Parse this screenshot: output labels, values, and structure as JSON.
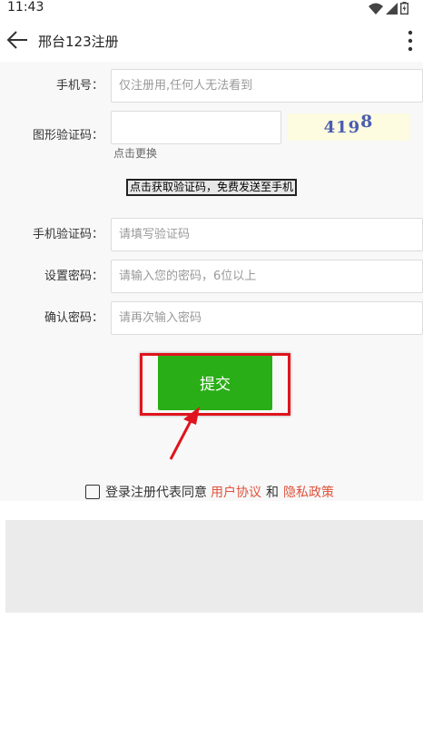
{
  "status_bar": {
    "time": "11:43"
  },
  "app_bar": {
    "title": "邢台123注册"
  },
  "form": {
    "phone_label": "手机号：",
    "phone_placeholder": "仅注册用,任何人无法看到",
    "captcha_label": "图形验证码：",
    "captcha_value": "",
    "captcha_image_text": "419",
    "captcha_image_text_sup": "8",
    "refresh_label": "点击更换",
    "get_code_label": "点击获取验证码，免费发送至手机",
    "sms_label": "手机验证码：",
    "sms_placeholder": "请填写验证码",
    "password_label": "设置密码：",
    "password_placeholder": "请输入您的密码，6位以上",
    "confirm_label": "确认密码：",
    "confirm_placeholder": "请再次输入密码",
    "submit_label": "提交"
  },
  "agreement": {
    "prefix": "登录注册代表同意",
    "user_agreement": "用户协议",
    "and": "和",
    "privacy_policy": "隐私政策",
    "link_color": "#e0533d"
  },
  "colors": {
    "accent": "#2aae17",
    "highlight": "#e0141e"
  }
}
